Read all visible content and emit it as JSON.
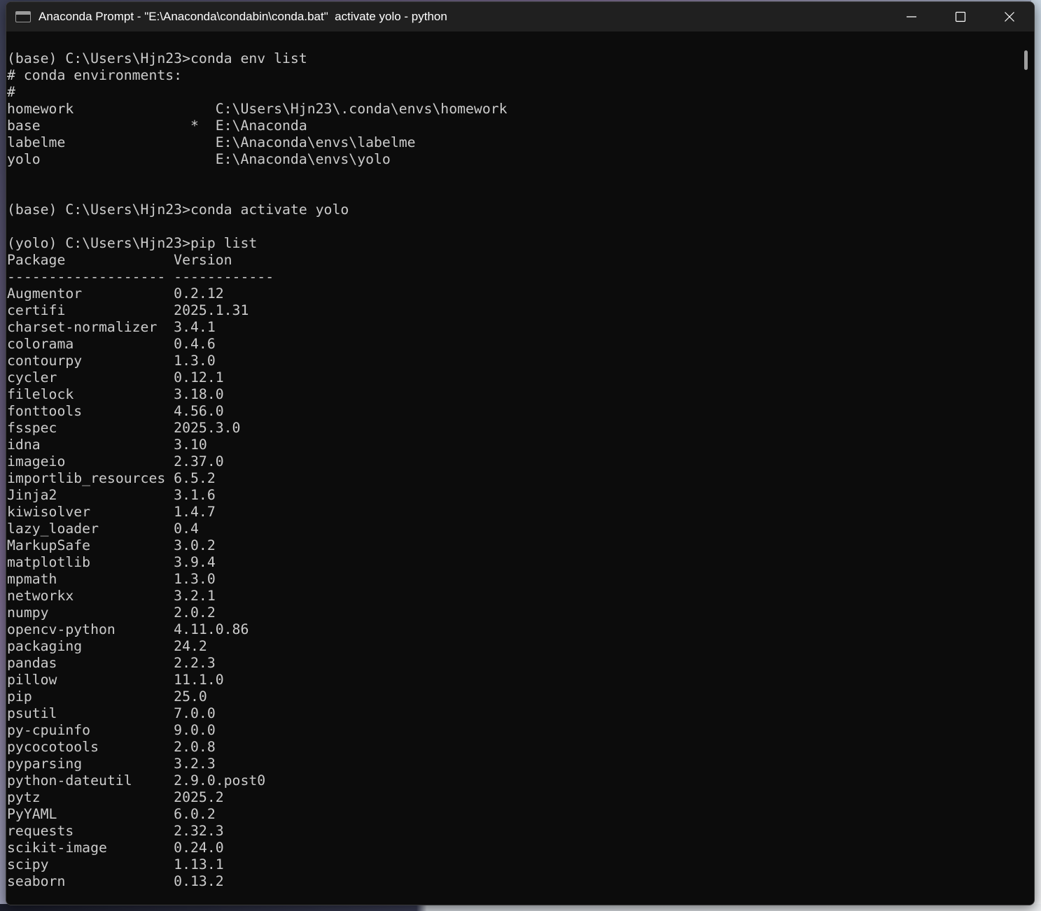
{
  "window": {
    "title": "Anaconda Prompt - \"E:\\Anaconda\\condabin\\conda.bat\"  activate yolo - python",
    "controls": {
      "minimize": "minimize-icon",
      "maximize": "maximize-icon",
      "close": "close-icon"
    }
  },
  "terminal": {
    "lines": [
      "(base) C:\\Users\\Hjn23>conda env list",
      "# conda environments:",
      "#",
      "homework                 C:\\Users\\Hjn23\\.conda\\envs\\homework",
      "base                  *  E:\\Anaconda",
      "labelme                  E:\\Anaconda\\envs\\labelme",
      "yolo                     E:\\Anaconda\\envs\\yolo",
      "",
      "",
      "(base) C:\\Users\\Hjn23>conda activate yolo",
      "",
      "(yolo) C:\\Users\\Hjn23>pip list",
      "Package             Version",
      "------------------- ------------",
      "Augmentor           0.2.12",
      "certifi             2025.1.31",
      "charset-normalizer  3.4.1",
      "colorama            0.4.6",
      "contourpy           1.3.0",
      "cycler              0.12.1",
      "filelock            3.18.0",
      "fonttools           4.56.0",
      "fsspec              2025.3.0",
      "idna                3.10",
      "imageio             2.37.0",
      "importlib_resources 6.5.2",
      "Jinja2              3.1.6",
      "kiwisolver          1.4.7",
      "lazy_loader         0.4",
      "MarkupSafe          3.0.2",
      "matplotlib          3.9.4",
      "mpmath              1.3.0",
      "networkx            3.2.1",
      "numpy               2.0.2",
      "opencv-python       4.11.0.86",
      "packaging           24.2",
      "pandas              2.2.3",
      "pillow              11.1.0",
      "pip                 25.0",
      "psutil              7.0.0",
      "py-cpuinfo          9.0.0",
      "pycocotools         2.0.8",
      "pyparsing           3.2.3",
      "python-dateutil     2.9.0.post0",
      "pytz                2025.2",
      "PyYAML              6.0.2",
      "requests            2.32.3",
      "scikit-image        0.24.0",
      "scipy               1.13.1",
      "seaborn             0.13.2"
    ]
  },
  "colors": {
    "terminal_background": "#0c0c0c",
    "terminal_foreground": "#cccccc",
    "titlebar_background": "#202020",
    "titlebar_text": "#ffffff"
  }
}
